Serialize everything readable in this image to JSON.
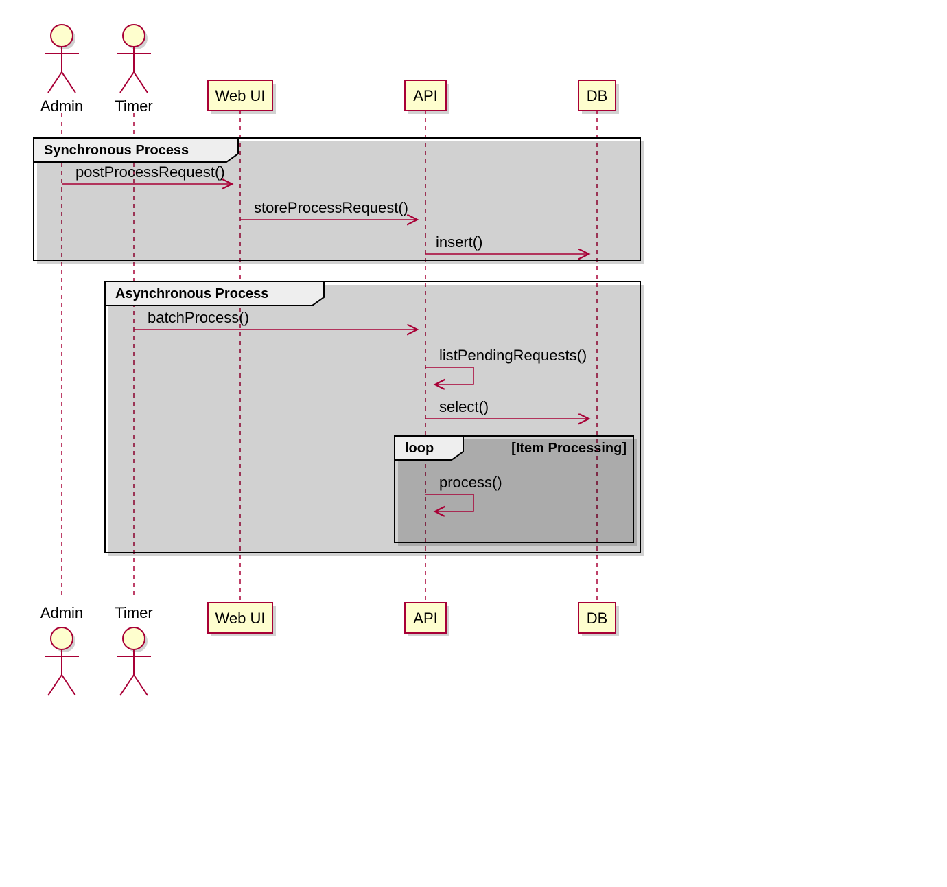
{
  "actors": {
    "admin": "Admin",
    "timer": "Timer"
  },
  "participants": {
    "webui": "Web UI",
    "api": "API",
    "db": "DB"
  },
  "groups": {
    "sync": "Synchronous Process",
    "async": "Asynchronous Process",
    "loop": "loop",
    "loopCond": "[Item Processing]"
  },
  "messages": {
    "m1": "postProcessRequest()",
    "m2": "storeProcessRequest()",
    "m3": "insert()",
    "m4": "batchProcess()",
    "m5": "listPendingRequests()",
    "m6": "select()",
    "m7": "process()"
  }
}
